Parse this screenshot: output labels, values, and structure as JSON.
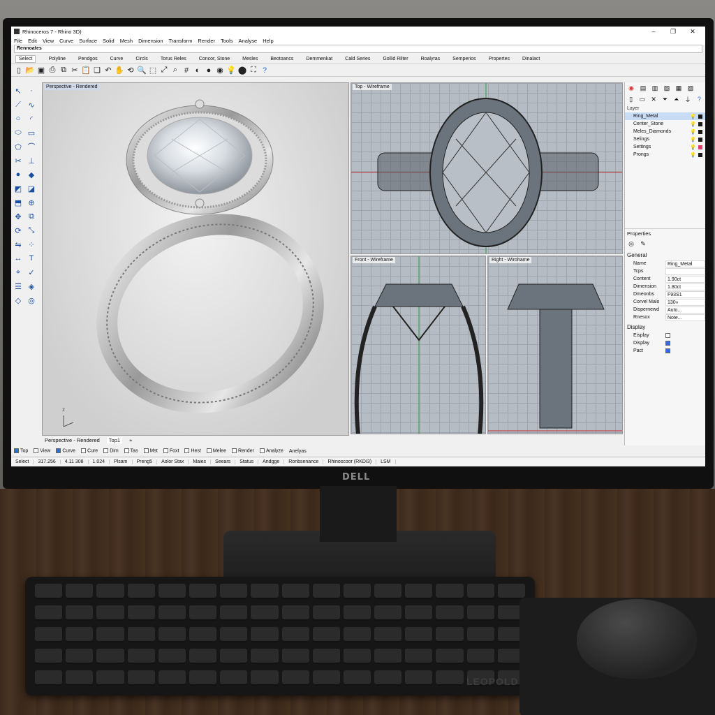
{
  "monitor": {
    "brand": "DELL"
  },
  "keyboard": {
    "brand": "LEOPOLD"
  },
  "window": {
    "title": "Rhinoceros 7 - Rhino 3D)",
    "min": "–",
    "max": "❐",
    "close": "✕"
  },
  "menu": [
    "File",
    "Edit",
    "View",
    "Curve",
    "Surface",
    "Solid",
    "Mesh",
    "Dimension",
    "Transform",
    "Render",
    "Tools",
    "Analyse",
    "Help"
  ],
  "command_prompt": "Rennoates",
  "toolbar_tabs": [
    "Select",
    "Polyline",
    "Pendgos",
    "Curve",
    "Circls",
    "Torus Reles",
    "Concor, Stone",
    "Mesles",
    "Beotoancs",
    "Demmenkat",
    "Cald Series",
    "Gollid Rilter",
    "Roalyras",
    "Semperios",
    "Propertes",
    "Dinalact"
  ],
  "toolbar_icons": [
    "new-icon",
    "open-icon",
    "save-icon",
    "print-icon",
    "copy-icon",
    "cut-icon",
    "paste-icon",
    "duplicate-icon",
    "undo-icon",
    "pan-icon",
    "rotate-icon",
    "zoom-icon",
    "zoom-window-icon",
    "zoom-extents-icon",
    "zoom-selected-icon",
    "grid-icon",
    "shade-icon",
    "render-icon",
    "material-icon",
    "light-icon",
    "sphere-icon",
    "camera-icon",
    "help-icon"
  ],
  "viewports": {
    "perspective": {
      "label": "Perspective - Rendered"
    },
    "top": {
      "label": "Top - Wireframe"
    },
    "front": {
      "label": "Front - Wireframe"
    },
    "right": {
      "label": "Right - Wirohame"
    }
  },
  "viewport_tabs": {
    "active": "Perspective - Rendered",
    "second": "Top1",
    "add": "+"
  },
  "osnaps": [
    {
      "label": "Top",
      "on": true
    },
    {
      "label": "View",
      "on": false
    },
    {
      "label": "Curve",
      "on": true
    },
    {
      "label": "Cure",
      "on": false
    },
    {
      "label": "Dim",
      "on": false
    },
    {
      "label": "Tas",
      "on": false
    },
    {
      "label": "Mst",
      "on": false
    },
    {
      "label": "Foxt",
      "on": false
    },
    {
      "label": "Hest",
      "on": false
    },
    {
      "label": "Melee",
      "on": false
    },
    {
      "label": "Render",
      "on": false
    },
    {
      "label": "Analyze",
      "on": false
    },
    {
      "label": "Anelyas",
      "on": false
    }
  ],
  "statusbar": [
    "Select",
    "317.256",
    "4.11 308",
    "1.024",
    "Plsam",
    "Preng5",
    "Aolor Stax",
    "Maies",
    "Seears",
    "Status",
    "Andgge",
    "Ronbsenance",
    "Rhinoscoor (RKDI3)",
    "LSM"
  ],
  "layers": {
    "header": "Layer",
    "rows": [
      {
        "name": "Ring_Metal",
        "selected": true,
        "color": "#1a1a1a"
      },
      {
        "name": "Center_Stone",
        "selected": false,
        "color": "#1a1a1a"
      },
      {
        "name": "Meles_Diamonds",
        "selected": false,
        "color": "#1a1a1a"
      },
      {
        "name": "Selings",
        "selected": false,
        "color": "#1a1a1a"
      },
      {
        "name": "Settings",
        "selected": false,
        "color": "#e04070"
      },
      {
        "name": "Prongs",
        "selected": false,
        "color": "#1a1a1a"
      }
    ]
  },
  "properties": {
    "title": "Properties",
    "general_header": "General",
    "rows": [
      {
        "key": "Name",
        "value": "Ring_Metal"
      },
      {
        "key": "Tcps",
        "value": ""
      },
      {
        "key": "Content",
        "value": "1.90ct"
      },
      {
        "key": "Dimension",
        "value": "1.80ct"
      },
      {
        "key": "Dmeonbs",
        "value": "F93S1"
      },
      {
        "key": "Corvel Malo",
        "value": "130»"
      },
      {
        "key": "Dispernewd",
        "value": "Auto..."
      },
      {
        "key": "Rnesox",
        "value": "Note..."
      }
    ],
    "display_header": "Display",
    "display_rows": [
      {
        "key": "Eisplay",
        "on": false
      },
      {
        "key": "Display",
        "on": true
      },
      {
        "key": "Pact",
        "on": true
      }
    ]
  }
}
